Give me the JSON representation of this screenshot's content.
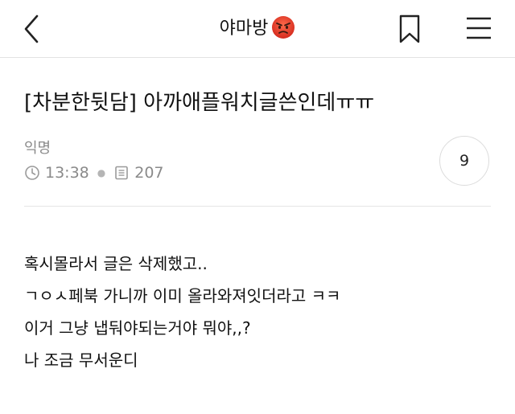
{
  "header": {
    "title": "야마방",
    "title_emoji": "angry-face-emoji"
  },
  "post": {
    "title": "[차분한뒷담] 아까애플워치글쓴인데ㅠㅠ",
    "author": "익명",
    "time": "13:38",
    "views": "207",
    "comment_count": "9",
    "body_lines": [
      "혹시몰라서 글은 삭제했고..",
      "ㄱㅇㅅ페북 가니까 이미 올라와져잇더라고 ㅋㅋ",
      "이거 그냥 냅둬야되는거야 뭐야,,?",
      "나 조금 무서운디"
    ]
  },
  "colors": {
    "text": "#111111",
    "meta": "#8a8a8a",
    "divider": "#e5e5e5",
    "emoji_red": "#e8453c"
  }
}
